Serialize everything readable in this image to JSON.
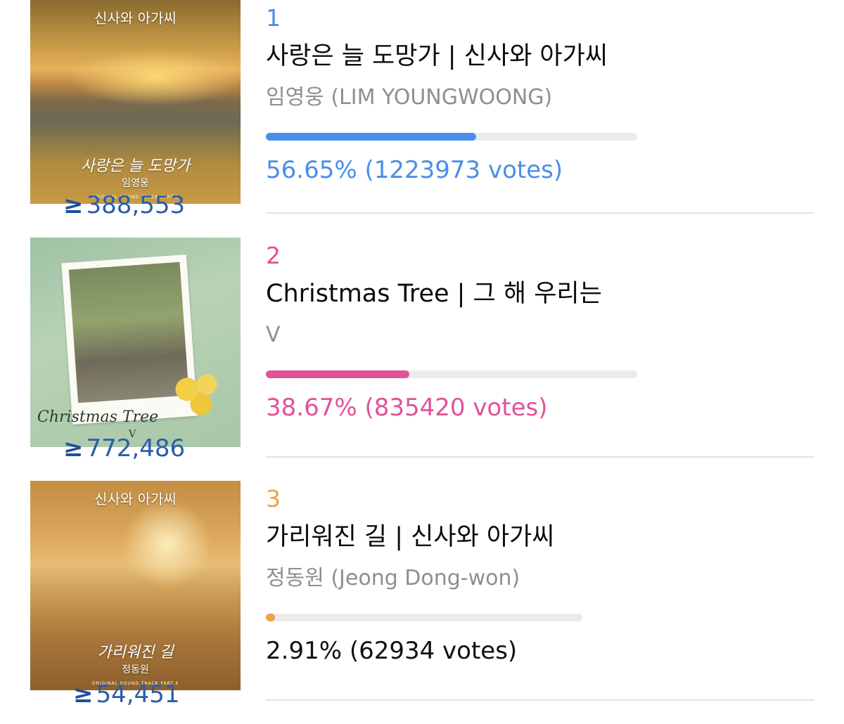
{
  "poll": {
    "options": [
      {
        "rank": "1",
        "title": "사랑은 늘 도망가 | 신사와 아가씨",
        "artist": "임영웅 (LIM YOUNGWOONG)",
        "percent_text": "56.65% (1223973 votes)",
        "percent": 56.65,
        "accent": "#4a8ee8",
        "track_width_label": "full",
        "count_symbol": "≥",
        "count": "388,553",
        "cover": {
          "title": "신사와 아가씨",
          "subtitle": "사랑은 늘 도망가",
          "artist": "임영웅",
          "ost": "ORIGINAL SOUND TRACK PART.2"
        }
      },
      {
        "rank": "2",
        "title": "Christmas Tree | 그 해 우리는",
        "artist": "V",
        "percent_text": "38.67% (835420 votes)",
        "percent": 38.67,
        "accent": "#e0529a",
        "track_width_label": "full",
        "count_symbol": "≥",
        "count": "772,486",
        "cover": {
          "title": "그 해 우리는",
          "subtitle": "Christmas Tree",
          "artist": "V",
          "ost": ""
        }
      },
      {
        "rank": "3",
        "title": "가리워진 길 | 신사와 아가씨",
        "artist": "정동원 (Jeong Dong-won)",
        "percent_text": "2.91% (62934 votes)",
        "percent": 2.91,
        "accent": "#f0a04b",
        "track_width_label": "short",
        "count_symbol": "≥",
        "count": "54,451",
        "cover": {
          "title": "신사와 아가씨",
          "subtitle": "가리워진 길",
          "artist": "정동원",
          "ost": "ORIGINAL SOUND TRACK PART.4"
        }
      }
    ],
    "colors": {
      "title": "#0b0b0b",
      "artist": "#8e8e93",
      "third_percent_text": "#111111",
      "count": "#2a5da8"
    }
  }
}
